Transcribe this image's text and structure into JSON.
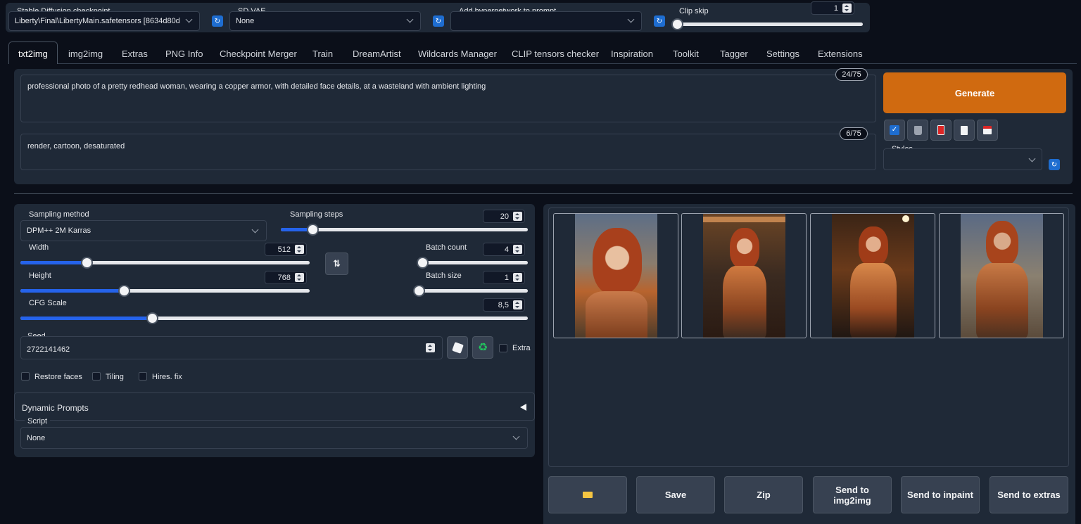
{
  "top": {
    "checkpoint": {
      "label": "Stable Diffusion checkpoint",
      "value": "Liberty\\Final\\LibertyMain.safetensors [8634d80d"
    },
    "vae": {
      "label": "SD VAE",
      "value": "None"
    },
    "hypernetwork": {
      "label": "Add hypernetwork to prompt",
      "value": ""
    },
    "clip_skip": {
      "label": "Clip skip",
      "value": "1"
    }
  },
  "tabs": [
    "txt2img",
    "img2img",
    "Extras",
    "PNG Info",
    "Checkpoint Merger",
    "Train",
    "DreamArtist",
    "Wildcards Manager",
    "CLIP tensors checker",
    "Inspiration",
    "Toolkit",
    "Tagger",
    "Settings",
    "Extensions"
  ],
  "prompt": {
    "positive": "professional photo of a pretty redhead woman, wearing a copper armor, with detailed face details, at a wasteland with ambient lighting",
    "positive_count": "24/75",
    "negative": "render, cartoon, desaturated",
    "negative_count": "6/75"
  },
  "generate_label": "Generate",
  "styles_label": "Styles",
  "tool_icons": [
    "check-icon",
    "trash-icon",
    "red-card-icon",
    "clipboard-icon",
    "save-disk-icon"
  ],
  "params": {
    "sampling_method": {
      "label": "Sampling method",
      "value": "DPM++ 2M Karras"
    },
    "sampling_steps": {
      "label": "Sampling steps",
      "value": "20",
      "fraction": 0.13
    },
    "width": {
      "label": "Width",
      "value": "512",
      "fraction": 0.23
    },
    "height": {
      "label": "Height",
      "value": "768",
      "fraction": 0.36
    },
    "batch_count": {
      "label": "Batch count",
      "value": "4",
      "fraction": 0.03
    },
    "batch_size": {
      "label": "Batch size",
      "value": "1",
      "fraction": 0.0
    },
    "cfg_scale": {
      "label": "CFG Scale",
      "value": "8,5",
      "fraction": 0.26
    },
    "seed": {
      "label": "Seed",
      "value": "2722141462"
    },
    "extra_label": "Extra",
    "restore_faces": "Restore faces",
    "tiling": "Tiling",
    "hires_fix": "Hires. fix",
    "dynamic_prompts": "Dynamic Prompts",
    "script": {
      "label": "Script",
      "value": "None"
    }
  },
  "actions": {
    "folder_icon": "folder-icon",
    "save": "Save",
    "zip": "Zip",
    "send_img2img": "Send to img2img",
    "send_inpaint": "Send to inpaint",
    "send_extras": "Send to extras"
  },
  "colors": {
    "accent": "#2563eb",
    "generate": "#d06a10"
  }
}
